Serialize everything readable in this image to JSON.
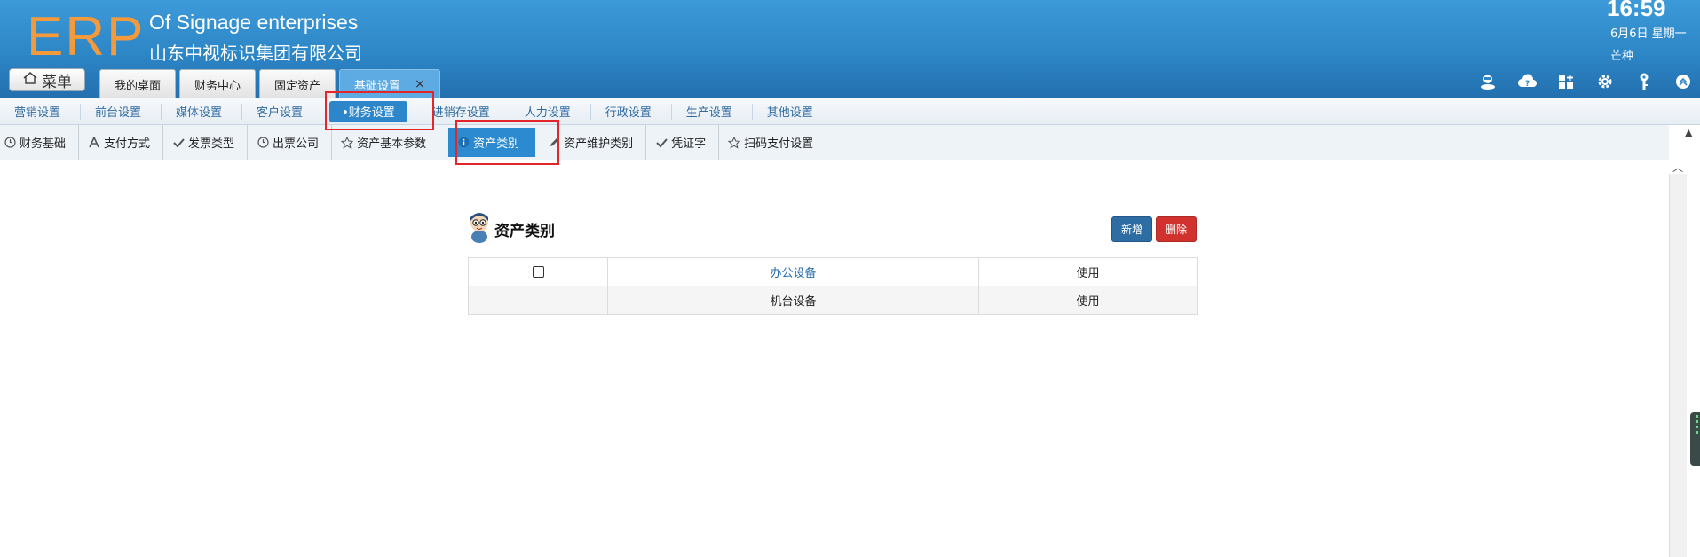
{
  "header": {
    "logo": "ERP",
    "company_en": "Of Signage enterprises",
    "company_cn": "山东中视标识集团有限公司",
    "time": "16:59",
    "date": "6月6日 星期一",
    "weather": "芒种",
    "menu_label": "菜单",
    "tabs": [
      {
        "label": "我的桌面"
      },
      {
        "label": "财务中心"
      },
      {
        "label": "固定资产"
      },
      {
        "label": "基础设置",
        "close": "×"
      }
    ],
    "icons": [
      "user-icon",
      "help-cloud-icon",
      "apps-grid-icon",
      "gear-icon",
      "key-icon",
      "collapse-up-icon"
    ]
  },
  "nav2": {
    "items": [
      {
        "label": "营销设置"
      },
      {
        "label": "前台设置"
      },
      {
        "label": "媒体设置"
      },
      {
        "label": "客户设置"
      },
      {
        "label": "•财务设置"
      },
      {
        "label": "进销存设置"
      },
      {
        "label": "人力设置"
      },
      {
        "label": "行政设置"
      },
      {
        "label": "生产设置"
      },
      {
        "label": "其他设置"
      }
    ]
  },
  "nav3": {
    "items": [
      {
        "label": "财务基础",
        "icon": "clock-icon"
      },
      {
        "label": "支付方式",
        "icon": "font-a-icon"
      },
      {
        "label": "发票类型",
        "icon": "check-icon"
      },
      {
        "label": "出票公司",
        "icon": "clock-icon"
      },
      {
        "label": "资产基本参数",
        "icon": "star-icon"
      },
      {
        "label": "资产类别",
        "icon": "info-icon"
      },
      {
        "label": "资产维护类别",
        "icon": "pencil-icon"
      },
      {
        "label": "凭证字",
        "icon": "check-icon"
      },
      {
        "label": "扫码支付设置",
        "icon": "star-icon"
      }
    ]
  },
  "content": {
    "title": "资产类别",
    "add_label": "新增",
    "delete_label": "删除",
    "rows": [
      {
        "name": "办公设备",
        "status": "使用"
      },
      {
        "name": "机台设备",
        "status": "使用"
      }
    ]
  },
  "colors": {
    "header_blue": "#2d86c6",
    "logo_orange": "#f39a3c",
    "active_blue": "#2c8bd0",
    "highlight_red": "#e2262a",
    "delete_red": "#d2322d"
  }
}
